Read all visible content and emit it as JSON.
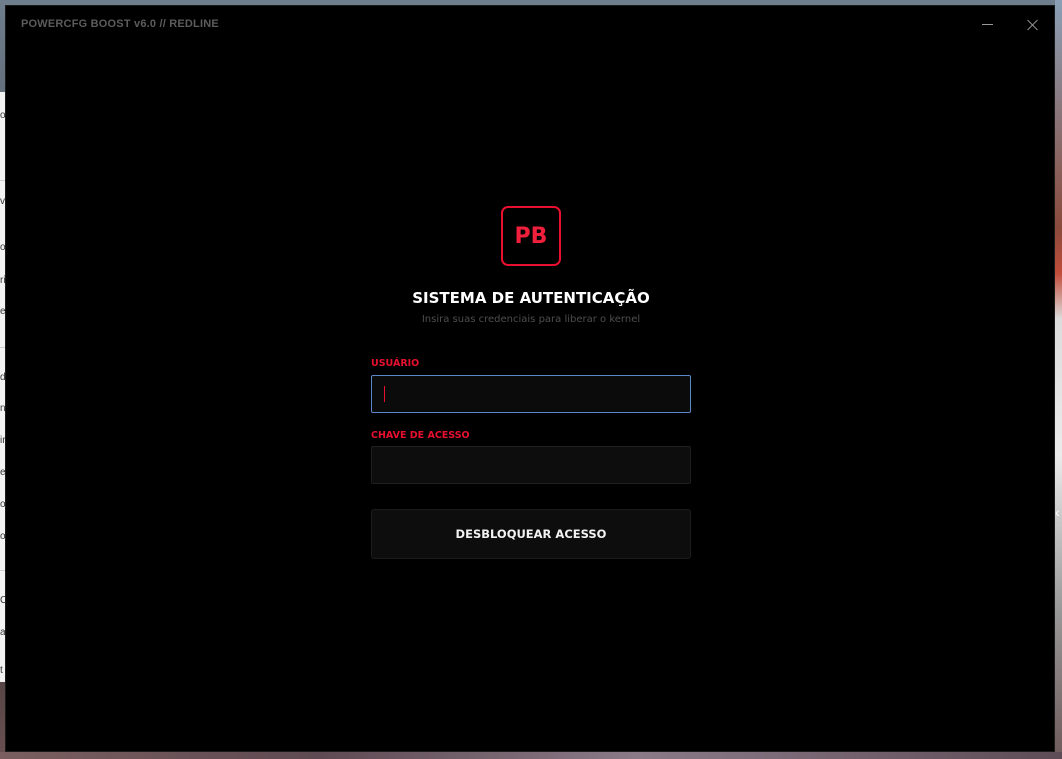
{
  "window": {
    "title": "POWERCFG BOOST v6.0 // REDLINE",
    "minimize_icon": "minimize-icon",
    "close_icon": "close-icon"
  },
  "auth": {
    "logo_text": "PB",
    "title": "SISTEMA DE AUTENTICAÇÃO",
    "subtitle": "Insira suas credenciais para liberar o kernel",
    "username_label": "USUÁRIO",
    "username_value": "",
    "key_label": "CHAVE DE ACESSO",
    "key_value": "",
    "unlock_label": "DESBLOQUEAR ACESSO"
  },
  "background": {
    "left_fragments": [
      "o",
      "v",
      "o",
      "ri",
      "e",
      "d",
      "n",
      "ir",
      "e",
      "o",
      "o",
      "C",
      "a",
      "t"
    ],
    "right_chevron": "‹"
  },
  "colors": {
    "accent": "#e8102e",
    "window_bg": "#000000",
    "field_bg": "#0d0d0d",
    "focus_border": "#5c88c7"
  }
}
